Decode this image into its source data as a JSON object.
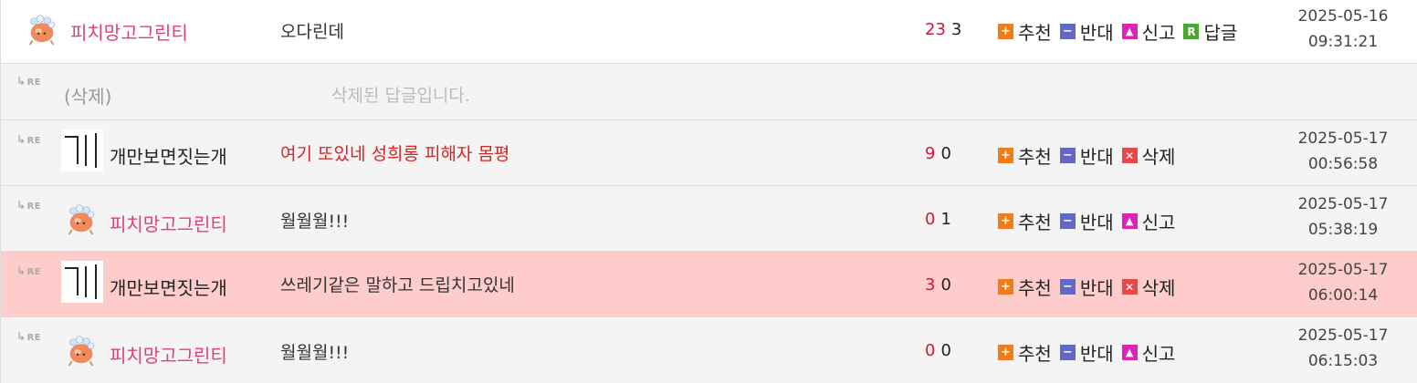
{
  "re_label": "RE",
  "action_labels": {
    "up": "추천",
    "down": "반대",
    "report": "신고",
    "delete": "삭제",
    "reply": "답글"
  },
  "comments": [
    {
      "name": "피치망고그린티",
      "content": "오다린데",
      "up": "23",
      "down": "3",
      "date": "2025-05-16",
      "time": "09:31:21"
    },
    {
      "name": "(삭제)",
      "content": "삭제된 답글입니다."
    },
    {
      "name": "개만보면짓는개",
      "content": "여기 또있네 성희롱 피해자 몸평",
      "up": "9",
      "down": "0",
      "date": "2025-05-17",
      "time": "00:56:58"
    },
    {
      "name": "피치망고그린티",
      "content": "월월월!!!",
      "up": "0",
      "down": "1",
      "date": "2025-05-17",
      "time": "05:38:19"
    },
    {
      "name": "개만보면짓는개",
      "content": "쓰레기같은 말하고 드립치고있네",
      "up": "3",
      "down": "0",
      "date": "2025-05-17",
      "time": "06:00:14"
    },
    {
      "name": "피치망고그린티",
      "content": "월월월!!!",
      "up": "0",
      "down": "0",
      "date": "2025-05-17",
      "time": "06:15:03"
    }
  ],
  "gae_glyph": "개",
  "colors": {
    "name_pink": "#e0407a",
    "content_red": "#dd2222",
    "highlight_row": "#ffcccc",
    "up_red": "#dd1133"
  }
}
